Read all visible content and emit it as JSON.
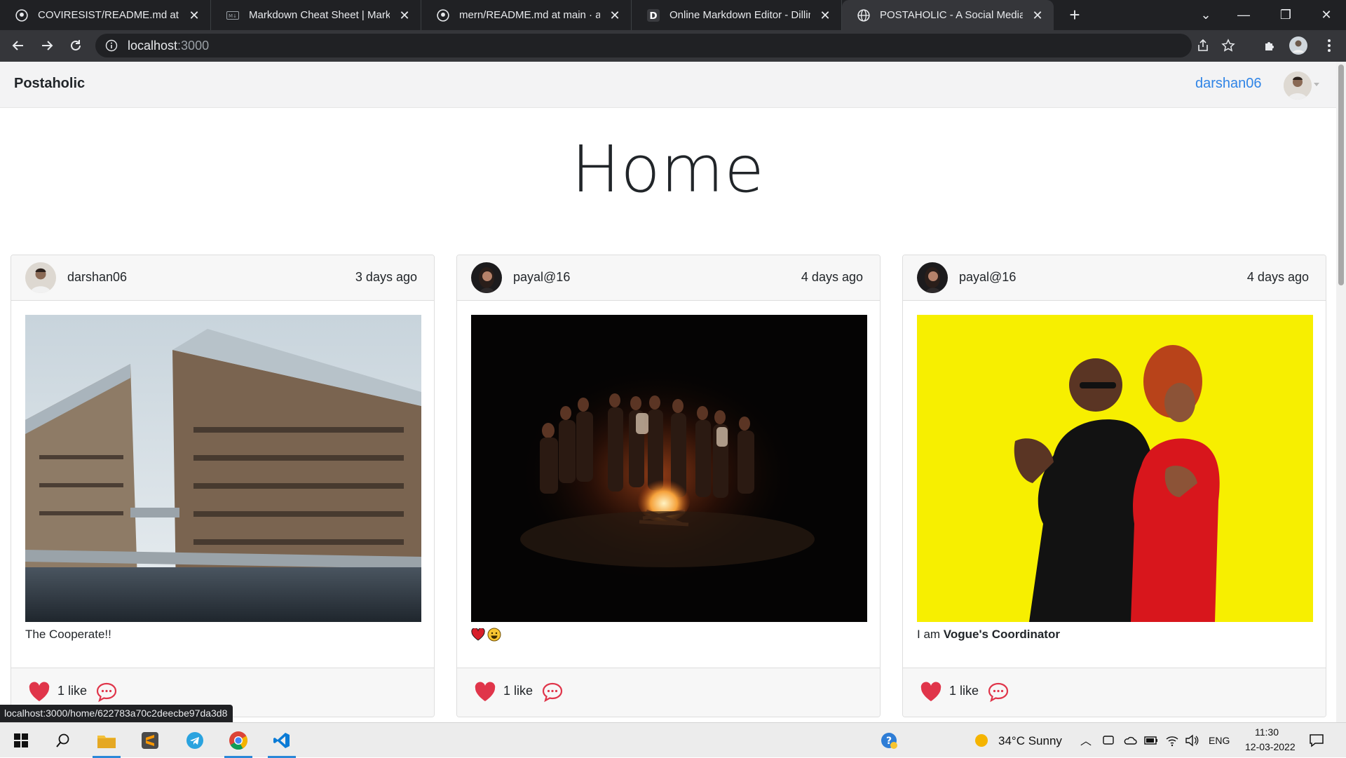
{
  "browser": {
    "tabs": [
      {
        "title": "COVIRESIST/README.md at mast",
        "icon": "github-icon"
      },
      {
        "title": "Markdown Cheat Sheet | Markdo",
        "icon": "markdown-icon"
      },
      {
        "title": "mern/README.md at main · ama",
        "icon": "github-icon"
      },
      {
        "title": "Online Markdown Editor - Dilling",
        "icon": "dillinger-icon"
      },
      {
        "title": "POSTAHOLIC - A Social Media W",
        "icon": "globe-icon",
        "active": true
      }
    ],
    "address": {
      "host": "localhost",
      "port": ":3000"
    },
    "status_url": "localhost:3000/home/622783a70c2deecbe97da3d8"
  },
  "app": {
    "brand": "Postaholic",
    "user": "darshan06",
    "page_title": "Home"
  },
  "posts": [
    {
      "author": "darshan06",
      "time": "3 days ago",
      "caption": "The Cooperate!!",
      "likes": "1 like",
      "image": "modern building by the water"
    },
    {
      "author": "payal@16",
      "time": "4 days ago",
      "caption": "",
      "emoji": [
        "red-heart",
        "grinning-face"
      ],
      "likes": "1 like",
      "image": "friends around a campfire at night"
    },
    {
      "author": "payal@16",
      "time": "4 days ago",
      "caption_prefix": "I am ",
      "caption_bold": "Vogue's Coordinator",
      "likes": "1 like",
      "image": "two models on yellow background"
    }
  ],
  "taskbar": {
    "apps": [
      "windows-start",
      "search",
      "file-explorer",
      "sublime-text",
      "telegram",
      "chrome",
      "vscode"
    ],
    "weather": "34°C  Sunny",
    "language": "ENG",
    "time": "11:30",
    "date": "12-03-2022"
  },
  "colors": {
    "accent": "#2f84e6",
    "heart": "#e0354a",
    "navbar": "#f3f3f4"
  }
}
